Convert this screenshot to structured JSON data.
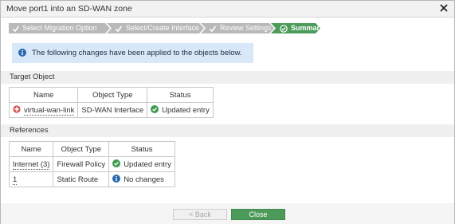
{
  "dialog": {
    "title": "Move port1 into an SD-WAN zone"
  },
  "stepper": {
    "steps": [
      {
        "label": "Select Migration Option",
        "state": "completed"
      },
      {
        "label": "Select/Create Interface",
        "state": "completed"
      },
      {
        "label": "Review Settings",
        "state": "completed"
      },
      {
        "label": "Summary",
        "state": "current"
      }
    ]
  },
  "info": {
    "message": "The following changes have been applied to the objects below."
  },
  "target_object": {
    "heading": "Target Object",
    "columns": [
      "Name",
      "Object Type",
      "Status"
    ],
    "row": {
      "name": "virtual-wan-link",
      "type": "SD-WAN Interface",
      "status": "Updated entry"
    }
  },
  "references": {
    "heading": "References",
    "columns": [
      "Name",
      "Object Type",
      "Status"
    ],
    "rows": [
      {
        "name": "Internet (3)",
        "type": "Firewall Policy",
        "status": "Updated entry"
      },
      {
        "name": "1",
        "type": "Static Route",
        "status": "No changes"
      }
    ]
  },
  "footer": {
    "back_label": "< Back",
    "close_label": "Close"
  },
  "colors": {
    "step_completed": "#b9b9b9",
    "step_current": "#4c9b5a",
    "success_green": "#3d9a4f",
    "info_blue": "#2a69b0",
    "info_box_bg": "#d9e8f8"
  }
}
